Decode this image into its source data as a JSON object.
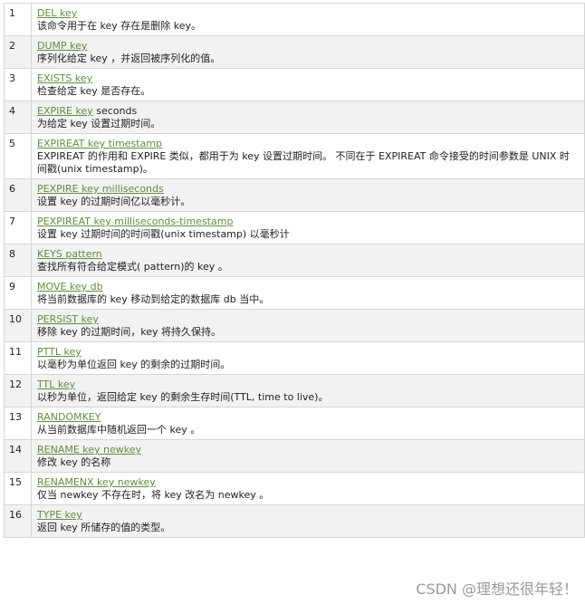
{
  "rows": [
    {
      "num": "1",
      "link": "DEL key",
      "suffix": "",
      "desc": "该命令用于在 key 存在是删除 key。"
    },
    {
      "num": "2",
      "link": "DUMP key",
      "suffix": "",
      "desc": "序列化给定 key ，并返回被序列化的值。"
    },
    {
      "num": "3",
      "link": "EXISTS key",
      "suffix": "",
      "desc": "检查给定 key 是否存在。"
    },
    {
      "num": "4",
      "link": "EXPIRE key",
      "suffix": " seconds",
      "desc": "为给定 key 设置过期时间。"
    },
    {
      "num": "5",
      "link": "EXPIREAT key timestamp",
      "suffix": "",
      "desc": "EXPIREAT 的作用和 EXPIRE 类似，都用于为 key 设置过期时间。 不同在于 EXPIREAT 命令接受的时间参数是 UNIX 时间戳(unix timestamp)。"
    },
    {
      "num": "6",
      "link": "PEXPIRE key milliseconds",
      "suffix": "",
      "desc": "设置 key 的过期时间亿以毫秒计。"
    },
    {
      "num": "7",
      "link": "PEXPIREAT key milliseconds-timestamp",
      "suffix": "",
      "desc": "设置 key 过期时间的时间戳(unix timestamp) 以毫秒计"
    },
    {
      "num": "8",
      "link": "KEYS pattern",
      "suffix": "",
      "desc": "查找所有符合给定模式( pattern)的 key 。"
    },
    {
      "num": "9",
      "link": "MOVE key db",
      "suffix": "",
      "desc": "将当前数据库的 key 移动到给定的数据库 db 当中。"
    },
    {
      "num": "10",
      "link": "PERSIST key",
      "suffix": "",
      "desc": "移除 key 的过期时间，key 将持久保持。"
    },
    {
      "num": "11",
      "link": "PTTL key",
      "suffix": "",
      "desc": "以毫秒为单位返回 key 的剩余的过期时间。"
    },
    {
      "num": "12",
      "link": "TTL key",
      "suffix": "",
      "desc": "以秒为单位，返回给定 key 的剩余生存时间(TTL, time to live)。"
    },
    {
      "num": "13",
      "link": "RANDOMKEY",
      "suffix": "",
      "desc": "从当前数据库中随机返回一个 key 。"
    },
    {
      "num": "14",
      "link": "RENAME key newkey",
      "suffix": "",
      "desc": "修改 key 的名称"
    },
    {
      "num": "15",
      "link": "RENAMENX key newkey",
      "suffix": "",
      "desc": "仅当 newkey 不存在时，将 key 改名为 newkey 。"
    },
    {
      "num": "16",
      "link": "TYPE key",
      "suffix": "",
      "desc": "返回 key 所储存的值的类型。"
    }
  ],
  "watermark": "CSDN @理想还很年轻！",
  "colors": {
    "link": "#5f8f3a",
    "row_alt": "#f2f2f2",
    "border": "#d6d6d6"
  }
}
